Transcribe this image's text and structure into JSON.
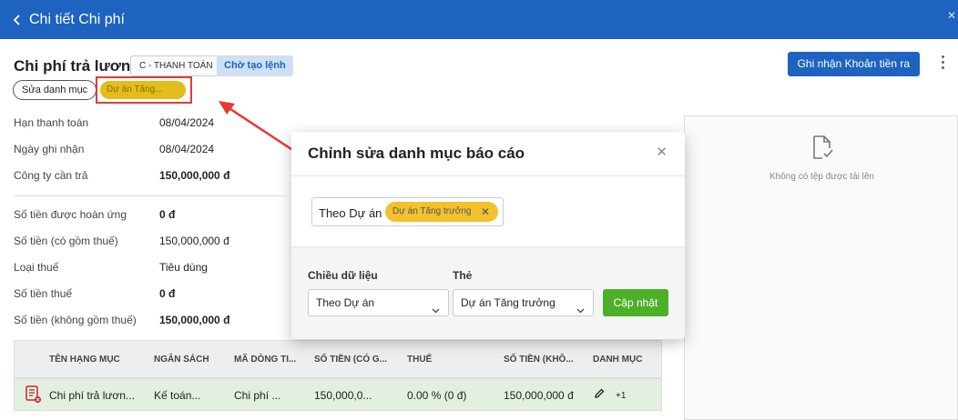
{
  "topbar": {
    "title": "Chi tiết Chi phí"
  },
  "header": {
    "title": "Chi phí trả lương",
    "badge_payment": "C - THANH TOÁN",
    "badge_status": "Chờ tạo lệnh",
    "primary_action": "Ghi nhận Khoản tiền ra",
    "edit_category": "Sửa danh mục",
    "tag": "Dự án Tăng..."
  },
  "info": [
    {
      "label": "Hạn thanh toán",
      "value": "08/04/2024"
    },
    {
      "label": "Ngày ghi nhận",
      "value": "08/04/2024"
    },
    {
      "label": "Công ty cần trả",
      "value": "150,000,000 đ"
    },
    {
      "label": "Số tiền được hoàn ứng",
      "value": "0 đ"
    },
    {
      "label": "Số tiền (có gồm thuế)",
      "value": "150,000,000 đ"
    },
    {
      "label": "Loại thuế",
      "value": "Tiêu dùng"
    },
    {
      "label": "Số tiền thuế",
      "value": "0 đ"
    },
    {
      "label": "Số tiền (không gồm thuế)",
      "value": "150,000,000 đ"
    }
  ],
  "upload": {
    "empty_text": "Không có tệp được tải lên"
  },
  "table": {
    "headers": [
      "TÊN HẠNG MỤC",
      "NGÂN SÁCH",
      "MÃ DÒNG TI...",
      "SỐ TIỀN (CÓ G...",
      "THUẾ",
      "SỐ TIỀN (KHÔ...",
      "DANH MỤC"
    ],
    "row": {
      "name": "Chi phí trả lươn...",
      "budget": "Kế toán...",
      "code": "Chi phí ...",
      "amount": "150,000,0...",
      "tax": "0.00 % (0 đ)",
      "amount_ex": "150,000,000 đ",
      "more": "+1"
    }
  },
  "modal": {
    "title": "Chỉnh sửa danh mục báo cáo",
    "filter_label": "Theo Dự án",
    "filter_chip": "Dự án Tăng trưởng",
    "dimension_label": "Chiều dữ liệu",
    "dimension_value": "Theo Dự án",
    "tag_label": "Thẻ",
    "tag_value": "Dự án Tăng trưởng",
    "submit": "Cập nhật"
  },
  "colors": {
    "primary": "#1e63c0",
    "tag_yellow": "#e2bd1c",
    "success": "#4caf28",
    "highlight": "#e53935"
  }
}
